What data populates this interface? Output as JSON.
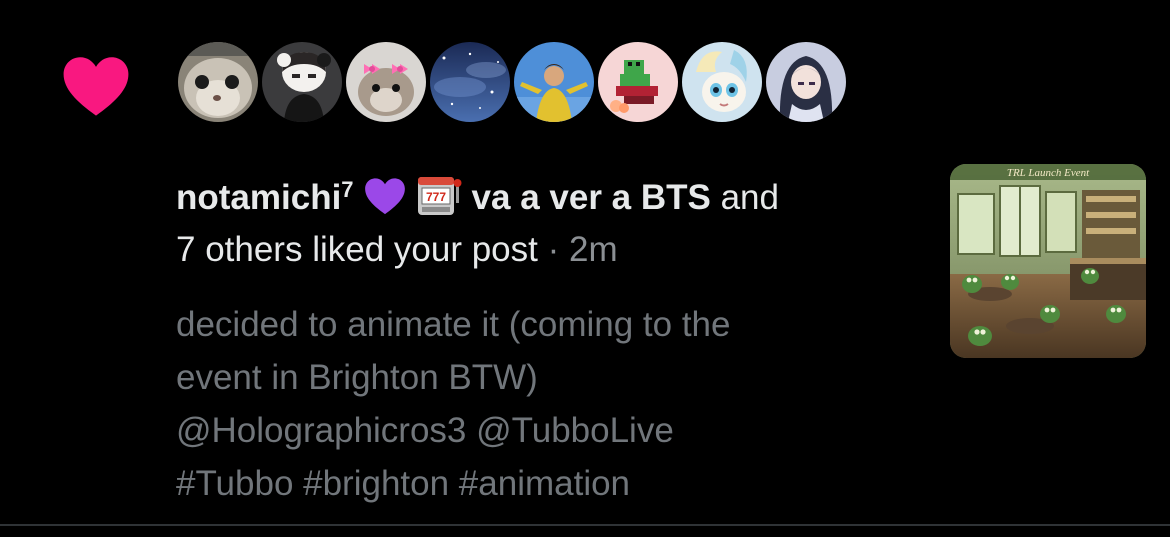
{
  "notification": {
    "type_icon": "heart-icon",
    "icon_color": "#f91880",
    "avatars": [
      {
        "name": "avatar-1",
        "style": "cat-photo"
      },
      {
        "name": "avatar-2",
        "style": "anime-character"
      },
      {
        "name": "avatar-3",
        "style": "hamster-bows"
      },
      {
        "name": "avatar-4",
        "style": "starry-night"
      },
      {
        "name": "avatar-5",
        "style": "person-sky"
      },
      {
        "name": "avatar-6",
        "style": "pixel-frog"
      },
      {
        "name": "avatar-7",
        "style": "pony-drawing"
      },
      {
        "name": "avatar-8",
        "style": "anime-girl"
      }
    ],
    "user_name": "notamichi",
    "user_name_sup": "7",
    "emoji_1": "purple-heart-icon",
    "emoji_2": "slot-machine-icon",
    "bio_text": "va a ver a BTS",
    "and_text": " and",
    "others_text": "7 others liked your post",
    "separator": " · ",
    "time": "2m",
    "post_lines": [
      "decided to animate it (coming to the",
      "event in Brighton BTW)",
      "@Holographicros3 @TubboLive",
      "#Tubbo #brighton #animation"
    ],
    "thumbnail": {
      "name": "post-thumbnail",
      "caption": "TRL Launch Event"
    }
  }
}
